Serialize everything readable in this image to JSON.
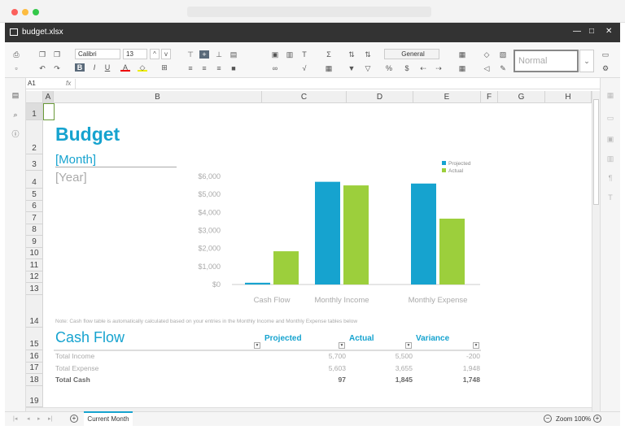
{
  "window": {
    "title": "budget.xlsx",
    "controls": [
      "—",
      "□",
      "✕"
    ]
  },
  "toolbar": {
    "font": "Calibri",
    "size": "13",
    "number_format": "General",
    "style": "Normal"
  },
  "formula_bar": {
    "cell_ref": "A1",
    "fx": "fx",
    "value": ""
  },
  "columns": [
    "A",
    "B",
    "C",
    "D",
    "E",
    "F",
    "G",
    "H"
  ],
  "rows": [
    "1",
    "2",
    "3",
    "4",
    "5",
    "6",
    "7",
    "8",
    "9",
    "10",
    "11",
    "12",
    "13",
    "14",
    "15",
    "16",
    "17",
    "18",
    "19"
  ],
  "sheet": {
    "title": "Budget",
    "month": "[Month]",
    "year": "[Year]",
    "note": "Note: Cash flow table is automatically calculated based on your entries in the Monthly Income and Monthly Expense tables below",
    "cashflow": {
      "title": "Cash Flow",
      "headers": [
        "Projected",
        "Actual",
        "Variance"
      ],
      "rows": [
        {
          "label": "Total Income",
          "values": [
            "5,700",
            "5,500",
            "-200"
          ]
        },
        {
          "label": "Total Expense",
          "values": [
            "5,603",
            "3,655",
            "1,948"
          ]
        },
        {
          "label": "Total Cash",
          "values": [
            "97",
            "1,845",
            "1,748"
          ]
        }
      ]
    }
  },
  "chart_data": {
    "type": "bar",
    "categories": [
      "Cash Flow",
      "Monthly Income",
      "Monthly Expense"
    ],
    "series": [
      {
        "name": "Projected",
        "values": [
          97,
          5700,
          5603
        ],
        "color": "#16a3cf"
      },
      {
        "name": "Actual",
        "values": [
          1845,
          5500,
          3655
        ],
        "color": "#9ccf3c"
      }
    ],
    "yticks": [
      "$0",
      "$1,000",
      "$2,000",
      "$3,000",
      "$4,000",
      "$5,000",
      "$6,000"
    ],
    "ylim": [
      0,
      6000
    ],
    "legend": "top-right",
    "grid": false
  },
  "footer": {
    "sheet_tab": "Current Month",
    "zoom": "Zoom 100%"
  }
}
